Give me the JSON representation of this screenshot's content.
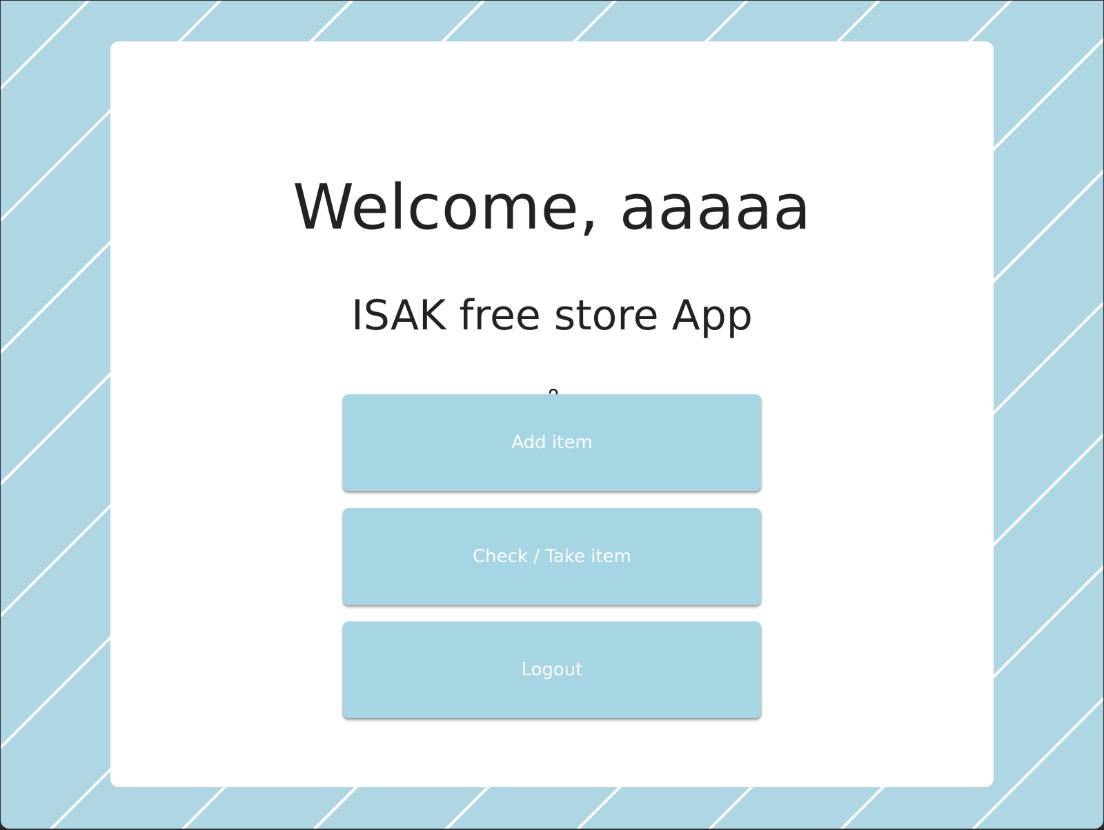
{
  "home": {
    "welcome_text": "Welcome, aaaaa",
    "app_title": "ISAK free store App",
    "icon": "clothes-hanger-icon"
  },
  "actions": {
    "add_item_label": "Add item",
    "check_take_item_label": "Check / Take item",
    "logout_label": "Logout"
  },
  "theme": {
    "background": "#aed6e3",
    "stripe": "#ffffff",
    "card": "#ffffff",
    "button": "#a6d5e4",
    "button_text": "#ffffff",
    "heading_text": "#222222"
  }
}
